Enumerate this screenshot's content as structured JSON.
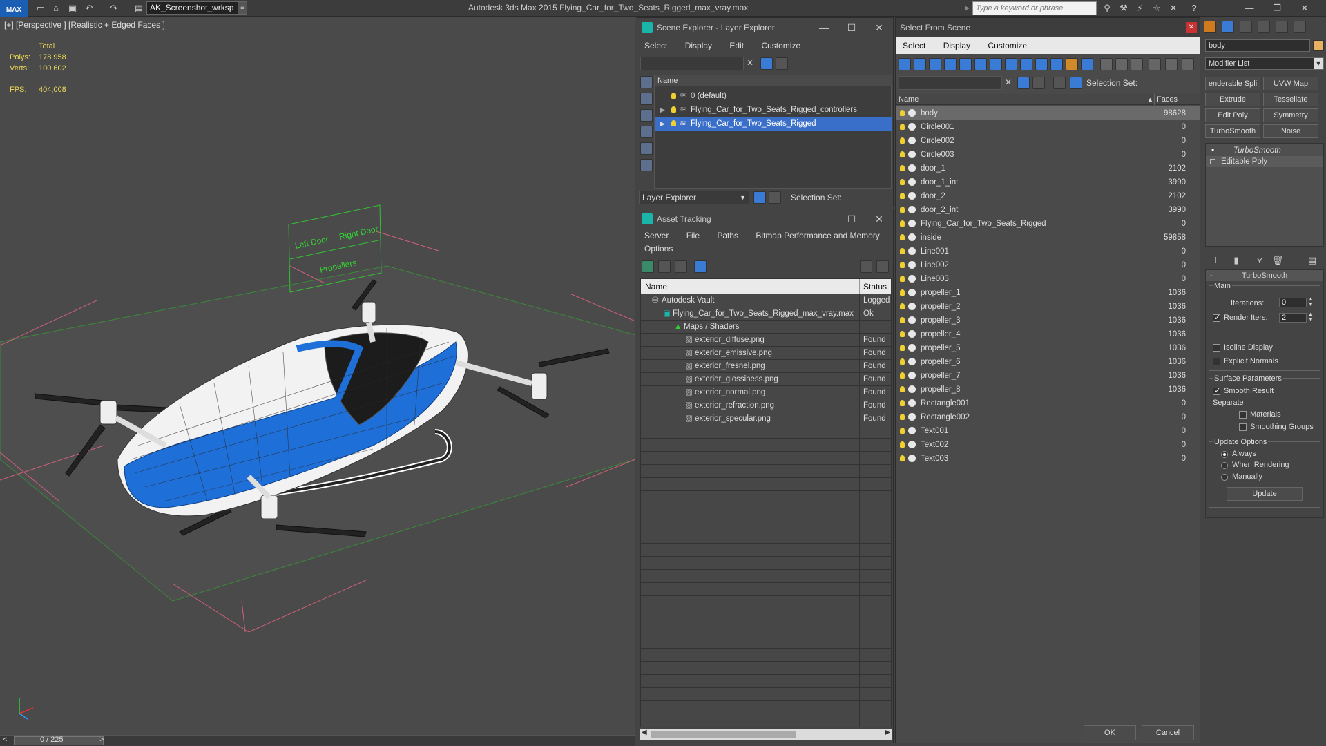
{
  "app": {
    "title": "Autodesk 3ds Max  2015    Flying_Car_for_Two_Seats_Rigged_max_vray.max",
    "workspace": "AK_Screenshot_wrksp",
    "search_placeholder": "Type a keyword or phrase",
    "logo": "MAX"
  },
  "viewport": {
    "label": "[+] [Perspective ] [Realistic + Edged Faces ]",
    "stats": {
      "total_label": "Total",
      "polys_label": "Polys:",
      "polys": "178 958",
      "verts_label": "Verts:",
      "verts": "100 602",
      "fps_label": "FPS:",
      "fps": "404,008"
    },
    "rig_labels": {
      "left_door": "Left Door",
      "right_door": "Right Door",
      "propellers": "Propellers"
    }
  },
  "timeline": {
    "frame": "0 / 225"
  },
  "scene_explorer": {
    "title": "Scene Explorer - Layer Explorer",
    "menu": [
      "Select",
      "Display",
      "Edit",
      "Customize"
    ],
    "col_name": "Name",
    "layers": [
      {
        "name": "0 (default)",
        "selected": false,
        "expand": false
      },
      {
        "name": "Flying_Car_for_Two_Seats_Rigged_controllers",
        "selected": false,
        "expand": true
      },
      {
        "name": "Flying_Car_for_Two_Seats_Rigged",
        "selected": true,
        "expand": true
      }
    ],
    "footer_dd": "Layer Explorer",
    "selection_set": "Selection Set:"
  },
  "asset_tracking": {
    "title": "Asset Tracking",
    "menu": [
      "Server",
      "File",
      "Paths",
      "Bitmap Performance and Memory"
    ],
    "menu2": "Options",
    "col_name": "Name",
    "col_status": "Status",
    "rows": [
      {
        "name": "Autodesk Vault",
        "status": "Logged",
        "indent": 0
      },
      {
        "name": "Flying_Car_for_Two_Seats_Rigged_max_vray.max",
        "status": "Ok",
        "indent": 1
      },
      {
        "name": "Maps / Shaders",
        "status": "",
        "indent": 2
      },
      {
        "name": "exterior_diffuse.png",
        "status": "Found",
        "indent": 3
      },
      {
        "name": "exterior_emissive.png",
        "status": "Found",
        "indent": 3
      },
      {
        "name": "exterior_fresnel.png",
        "status": "Found",
        "indent": 3
      },
      {
        "name": "exterior_glossiness.png",
        "status": "Found",
        "indent": 3
      },
      {
        "name": "exterior_normal.png",
        "status": "Found",
        "indent": 3
      },
      {
        "name": "exterior_refraction.png",
        "status": "Found",
        "indent": 3
      },
      {
        "name": "exterior_specular.png",
        "status": "Found",
        "indent": 3
      }
    ]
  },
  "select_from_scene": {
    "title": "Select From Scene",
    "menu": [
      "Select",
      "Display",
      "Customize"
    ],
    "selection_set": "Selection Set:",
    "col_name": "Name",
    "col_faces": "Faces",
    "ok": "OK",
    "cancel": "Cancel",
    "objects": [
      {
        "name": "body",
        "faces": "98628"
      },
      {
        "name": "Circle001",
        "faces": "0"
      },
      {
        "name": "Circle002",
        "faces": "0"
      },
      {
        "name": "Circle003",
        "faces": "0"
      },
      {
        "name": "door_1",
        "faces": "2102"
      },
      {
        "name": "door_1_int",
        "faces": "3990"
      },
      {
        "name": "door_2",
        "faces": "2102"
      },
      {
        "name": "door_2_int",
        "faces": "3990"
      },
      {
        "name": "Flying_Car_for_Two_Seats_Rigged",
        "faces": "0"
      },
      {
        "name": "inside",
        "faces": "59858"
      },
      {
        "name": "Line001",
        "faces": "0"
      },
      {
        "name": "Line002",
        "faces": "0"
      },
      {
        "name": "Line003",
        "faces": "0"
      },
      {
        "name": "propeller_1",
        "faces": "1036"
      },
      {
        "name": "propeller_2",
        "faces": "1036"
      },
      {
        "name": "propeller_3",
        "faces": "1036"
      },
      {
        "name": "propeller_4",
        "faces": "1036"
      },
      {
        "name": "propeller_5",
        "faces": "1036"
      },
      {
        "name": "propeller_6",
        "faces": "1036"
      },
      {
        "name": "propeller_7",
        "faces": "1036"
      },
      {
        "name": "propeller_8",
        "faces": "1036"
      },
      {
        "name": "Rectangle001",
        "faces": "0"
      },
      {
        "name": "Rectangle002",
        "faces": "0"
      },
      {
        "name": "Text001",
        "faces": "0"
      },
      {
        "name": "Text002",
        "faces": "0"
      },
      {
        "name": "Text003",
        "faces": "0"
      }
    ]
  },
  "command_panel": {
    "object_name": "body",
    "modifier_list": "Modifier List",
    "buttons": [
      "enderable Spli",
      "UVW Map",
      "Extrude",
      "Tessellate",
      "Edit Poly",
      "Symmetry",
      "TurboSmooth",
      "Noise"
    ],
    "stack": [
      "TurboSmooth",
      "Editable Poly"
    ],
    "rollout": {
      "title": "TurboSmooth",
      "main": "Main",
      "iterations_label": "Iterations:",
      "iterations": "0",
      "render_iters_label": "Render Iters:",
      "render_iters": "2",
      "isoline": "Isoline Display",
      "explicit": "Explicit Normals",
      "surface": "Surface Parameters",
      "smooth_result": "Smooth Result",
      "separate": "Separate",
      "materials": "Materials",
      "smoothing_groups": "Smoothing Groups",
      "update_options": "Update Options",
      "always": "Always",
      "when_rendering": "When Rendering",
      "manually": "Manually",
      "update": "Update"
    }
  },
  "colors": {
    "accent": "#3a6fc9",
    "stats": "#eeda56",
    "car_blue": "#1f6fd8"
  }
}
